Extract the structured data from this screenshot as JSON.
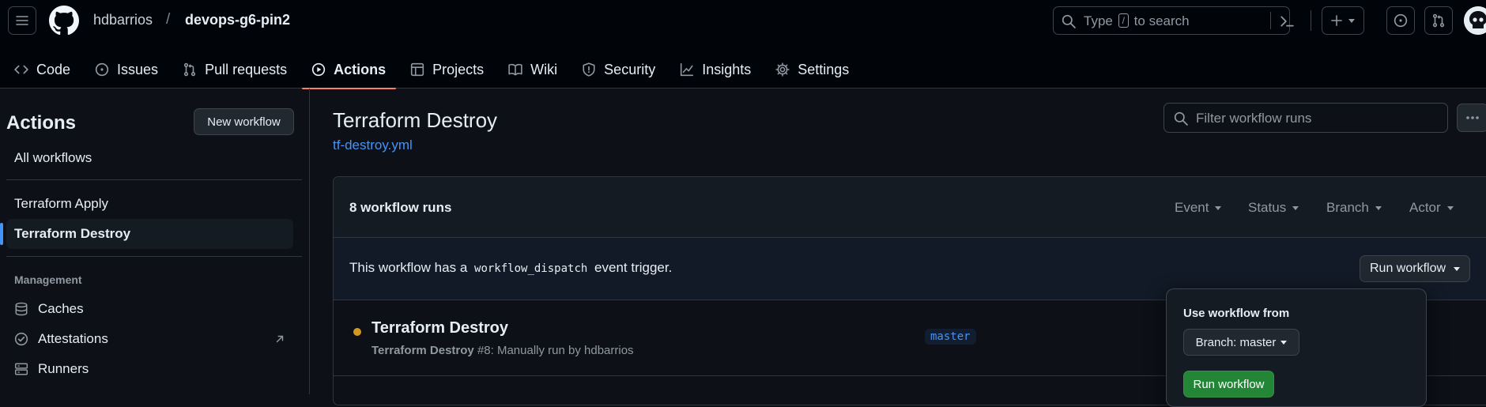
{
  "header": {
    "owner": "hdbarrios",
    "separator": "/",
    "repo": "devops-g6-pin2",
    "search_before": "Type",
    "search_key": "/",
    "search_after": "to search"
  },
  "tabs": [
    {
      "label": "Code",
      "icon": "code-icon"
    },
    {
      "label": "Issues",
      "icon": "issue-opened-icon"
    },
    {
      "label": "Pull requests",
      "icon": "git-pull-request-icon"
    },
    {
      "label": "Actions",
      "icon": "play-icon",
      "active": true
    },
    {
      "label": "Projects",
      "icon": "table-icon"
    },
    {
      "label": "Wiki",
      "icon": "book-icon"
    },
    {
      "label": "Security",
      "icon": "shield-icon"
    },
    {
      "label": "Insights",
      "icon": "graph-icon"
    },
    {
      "label": "Settings",
      "icon": "gear-icon"
    }
  ],
  "sidebar": {
    "title": "Actions",
    "new_workflow": "New workflow",
    "all_workflows": "All workflows",
    "workflows": [
      {
        "label": "Terraform Apply"
      },
      {
        "label": "Terraform Destroy",
        "active": true
      }
    ],
    "management_heading": "Management",
    "management": [
      {
        "label": "Caches",
        "icon": "database-icon"
      },
      {
        "label": "Attestations",
        "icon": "verified-icon"
      },
      {
        "label": "Runners",
        "icon": "server-icon"
      }
    ]
  },
  "main": {
    "title": "Terraform Destroy",
    "file": "tf-destroy.yml",
    "filter_placeholder": "Filter workflow runs",
    "runs_count": "8 workflow runs",
    "filters": [
      "Event",
      "Status",
      "Branch",
      "Actor"
    ],
    "dispatch_prefix": "This workflow has a",
    "dispatch_code": "workflow_dispatch",
    "dispatch_suffix": "event trigger.",
    "run_workflow_btn": "Run workflow",
    "run": {
      "title": "Terraform Destroy",
      "sub_bold": "Terraform Destroy",
      "sub_rest": "#8: Manually run by hdbarrios",
      "branch": "master",
      "status_color": "#d29922"
    }
  },
  "popover": {
    "title": "Use workflow from",
    "branch_select": "Branch: master",
    "run_button": "Run workflow"
  },
  "colors": {
    "accent": "#4493f8",
    "tab_underline": "#f78166",
    "run_button": "#238636"
  }
}
